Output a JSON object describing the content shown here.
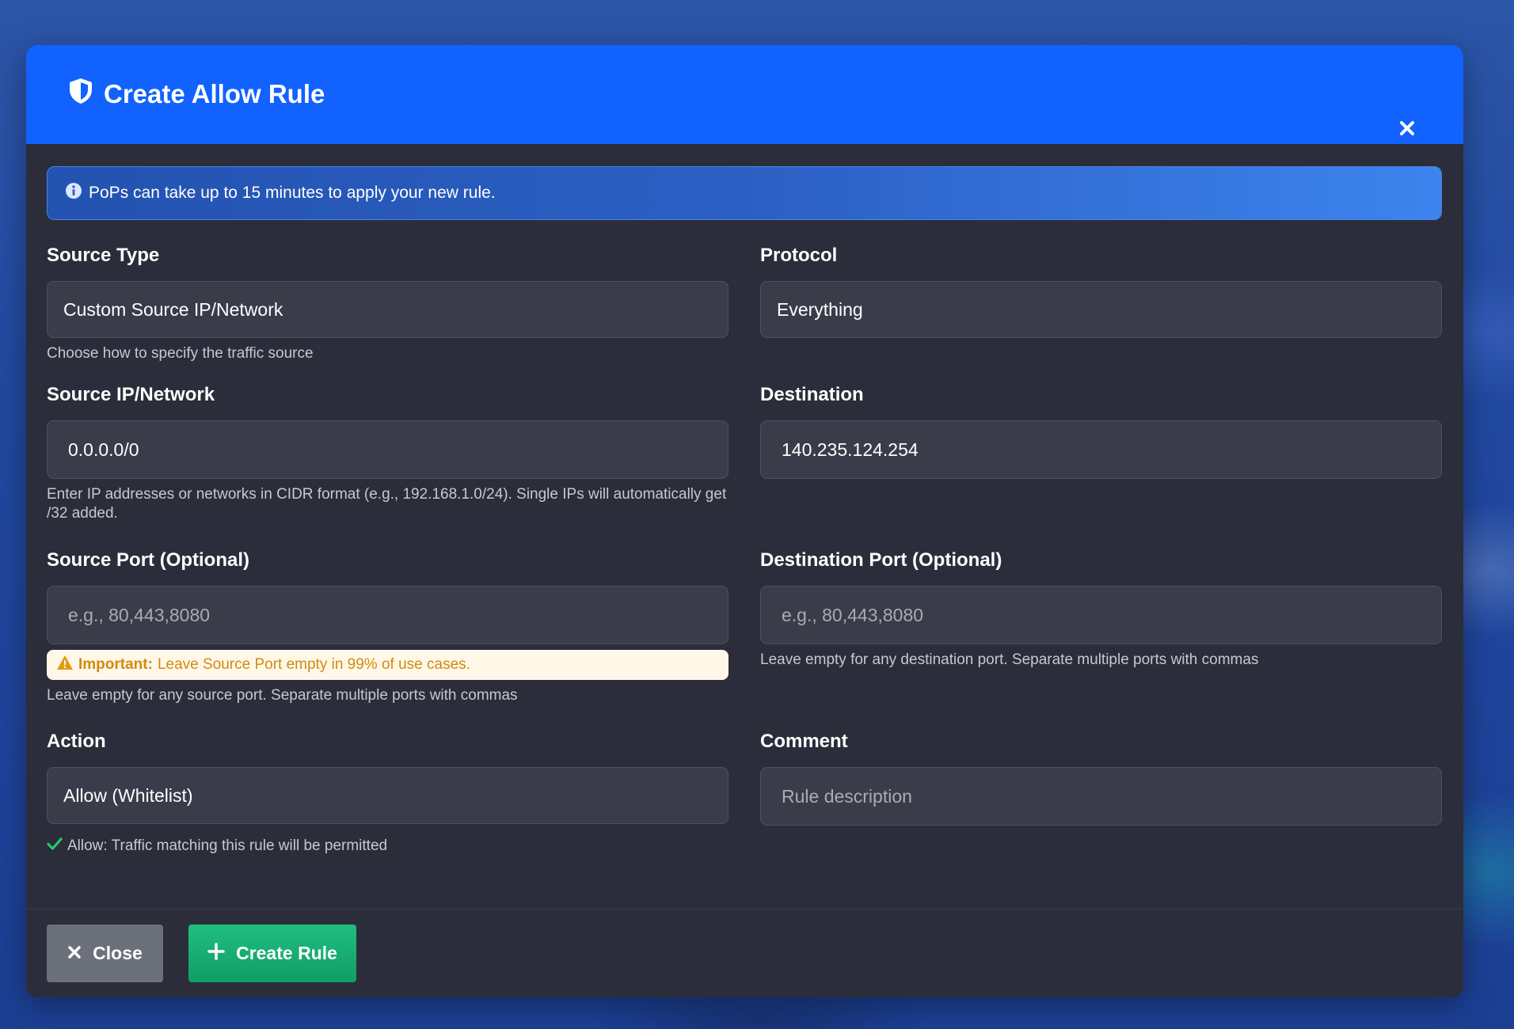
{
  "modal": {
    "title": "Create Allow Rule"
  },
  "alert": {
    "text": "PoPs can take up to 15 minutes to apply your new rule."
  },
  "fields": {
    "source_type": {
      "label": "Source Type",
      "value": "Custom Source IP/Network",
      "help": "Choose how to specify the traffic source"
    },
    "protocol": {
      "label": "Protocol",
      "value": "Everything"
    },
    "source_ip": {
      "label": "Source IP/Network",
      "value": "0.0.0.0/0",
      "help": "Enter IP addresses or networks in CIDR format (e.g., 192.168.1.0/24). Single IPs will automatically get /32 added."
    },
    "destination": {
      "label": "Destination",
      "value": "140.235.124.254"
    },
    "source_port": {
      "label": "Source Port (Optional)",
      "value": "",
      "placeholder": "e.g., 80,443,8080",
      "warning_bold": "Important:",
      "warning_text": "Leave Source Port empty in 99% of use cases.",
      "help": "Leave empty for any source port. Separate multiple ports with commas"
    },
    "destination_port": {
      "label": "Destination Port (Optional)",
      "value": "",
      "placeholder": "e.g., 80,443,8080",
      "help": "Leave empty for any destination port. Separate multiple ports with commas"
    },
    "action": {
      "label": "Action",
      "value": "Allow (Whitelist)",
      "help": "Allow: Traffic matching this rule will be permitted"
    },
    "comment": {
      "label": "Comment",
      "value": "",
      "placeholder": "Rule description"
    }
  },
  "footer": {
    "close_label": "Close",
    "create_label": "Create Rule"
  },
  "colors": {
    "header": "#1162fe",
    "modal_bg": "#2b2d3b",
    "input_bg": "#3b3c4a",
    "create_button": "#18b072",
    "close_button": "#6b707a",
    "warning_bg": "#fff8e8",
    "warning_text": "#d28a10",
    "success": "#2ec866"
  }
}
